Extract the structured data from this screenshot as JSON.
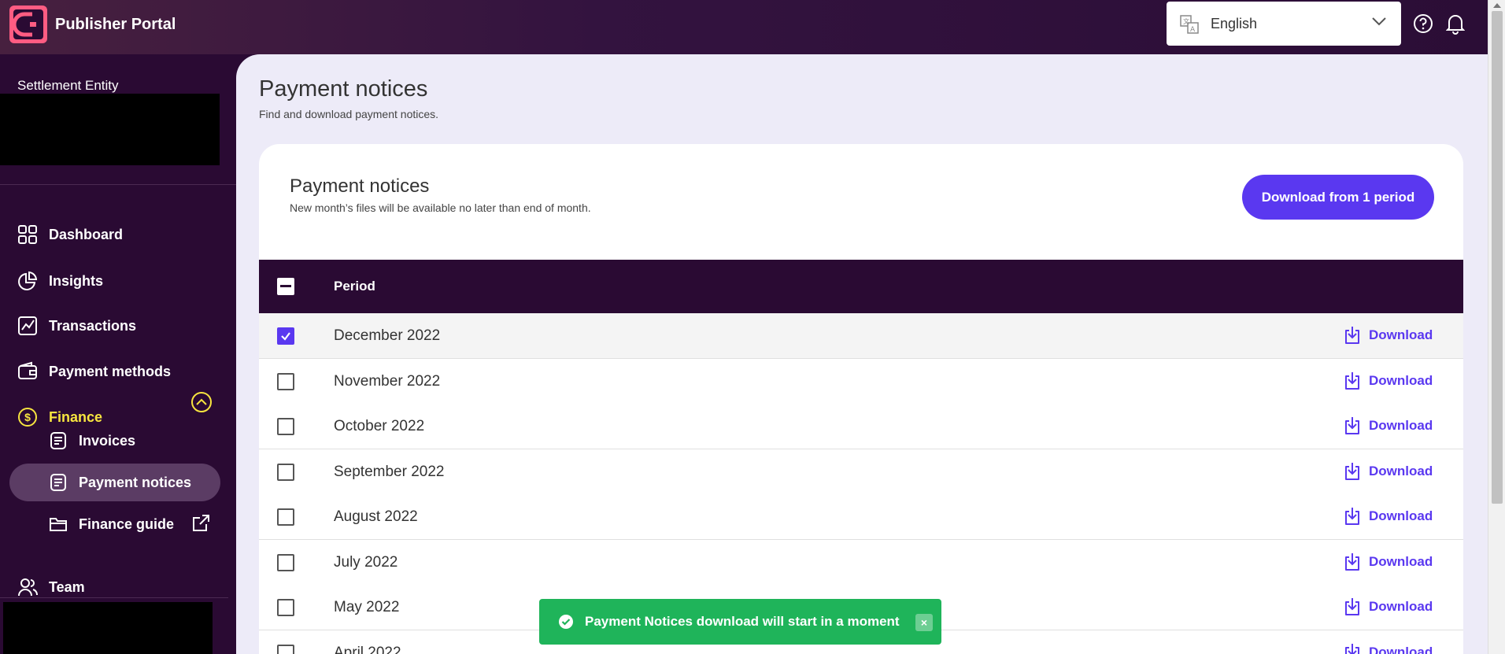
{
  "header": {
    "app_title": "Publisher Portal",
    "language": "English",
    "help_icon": "help-circle-icon",
    "notifications_icon": "bell-icon"
  },
  "sidebar": {
    "entity_label": "Settlement Entity",
    "items": [
      {
        "label": "Dashboard",
        "icon": "dashboard-icon"
      },
      {
        "label": "Insights",
        "icon": "pie-chart-icon"
      },
      {
        "label": "Transactions",
        "icon": "trend-icon"
      },
      {
        "label": "Payment methods",
        "icon": "wallet-icon"
      },
      {
        "label": "Finance",
        "icon": "dollar-icon"
      },
      {
        "label": "Team",
        "icon": "users-icon"
      }
    ],
    "finance_sub": [
      {
        "label": "Invoices",
        "icon": "document-icon"
      },
      {
        "label": "Payment notices",
        "icon": "document-icon"
      },
      {
        "label": "Finance guide",
        "icon": "folder-icon"
      }
    ]
  },
  "page": {
    "title": "Payment notices",
    "subtitle": "Find and download payment notices."
  },
  "card": {
    "title": "Payment notices",
    "subtitle": "New month’s files will be available no later than end of month.",
    "download_button": "Download from 1 period",
    "column_period": "Period",
    "download_label": "Download",
    "rows": [
      {
        "period": "December 2022",
        "checked": true
      },
      {
        "period": "November 2022",
        "checked": false
      },
      {
        "period": "October 2022",
        "checked": false
      },
      {
        "period": "September 2022",
        "checked": false
      },
      {
        "period": "August 2022",
        "checked": false
      },
      {
        "period": "July 2022",
        "checked": false
      },
      {
        "period": "May 2022",
        "checked": false
      },
      {
        "period": "April 2022",
        "checked": false
      }
    ]
  },
  "toast": {
    "message": "Payment Notices download will start in a moment",
    "close": "×"
  },
  "colors": {
    "accent": "#5a38f0",
    "sidebar_bg": "#2a0a33",
    "finance_yellow": "#f7e53f",
    "toast_green": "#1fb45a"
  }
}
